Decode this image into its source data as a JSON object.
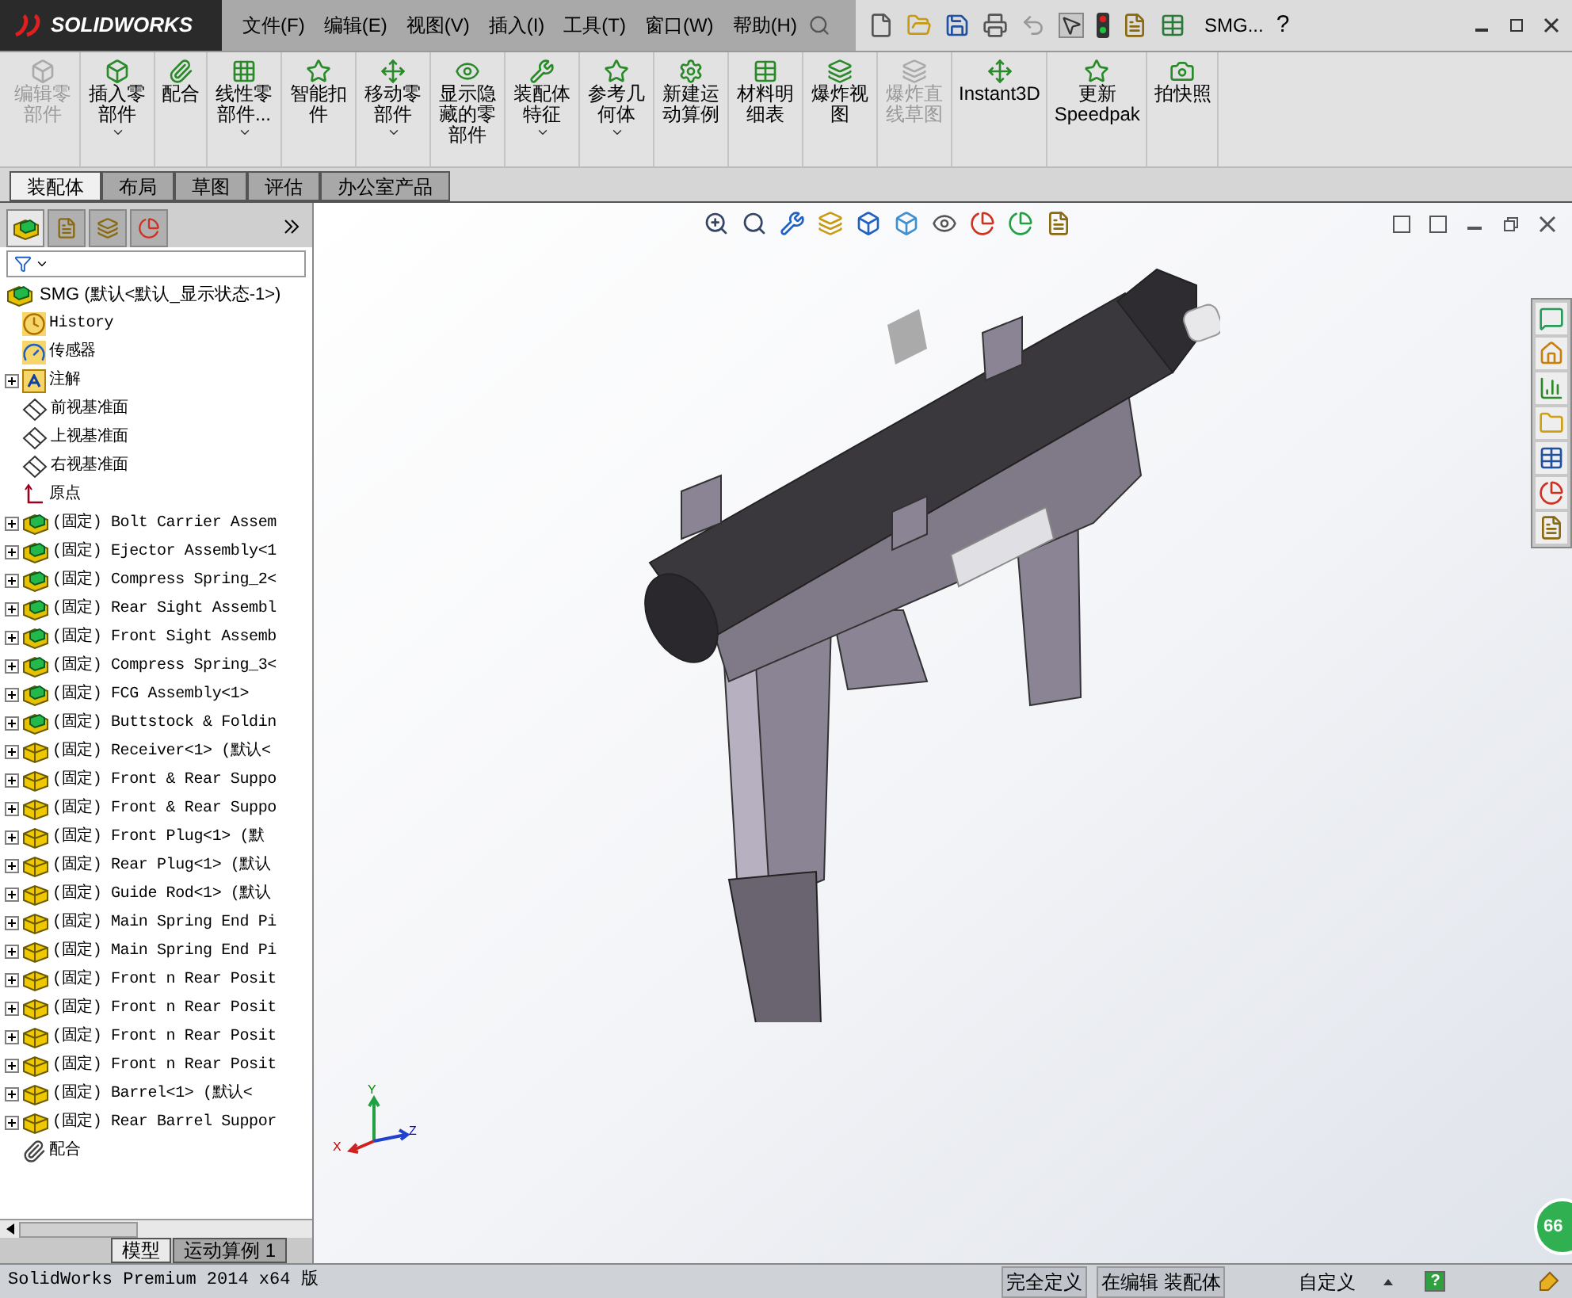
{
  "app": {
    "logo": "SOLIDWORKS"
  },
  "menu": [
    "文件(F)",
    "编辑(E)",
    "视图(V)",
    "插入(I)",
    "工具(T)",
    "窗口(W)",
    "帮助(H)"
  ],
  "title_bar": {
    "document": "SMG...",
    "help": "?"
  },
  "ribbon": [
    {
      "label": "编辑零部件",
      "disabled": true,
      "dropdown": false
    },
    {
      "label": "插入零部件",
      "disabled": false,
      "dropdown": true
    },
    {
      "label": "配合",
      "disabled": false,
      "dropdown": false
    },
    {
      "label": "线性零部件...",
      "disabled": false,
      "dropdown": true
    },
    {
      "label": "智能扣件",
      "disabled": false,
      "dropdown": false
    },
    {
      "label": "移动零部件",
      "disabled": false,
      "dropdown": true
    },
    {
      "label": "显示隐藏的零部件",
      "disabled": false,
      "dropdown": false
    },
    {
      "label": "装配体特征",
      "disabled": false,
      "dropdown": true
    },
    {
      "label": "参考几何体",
      "disabled": false,
      "dropdown": true
    },
    {
      "label": "新建运动算例",
      "disabled": false,
      "dropdown": false
    },
    {
      "label": "材料明细表",
      "disabled": false,
      "dropdown": false
    },
    {
      "label": "爆炸视图",
      "disabled": false,
      "dropdown": false
    },
    {
      "label": "爆炸直线草图",
      "disabled": true,
      "dropdown": false
    },
    {
      "label": "Instant3D",
      "disabled": false,
      "dropdown": false
    },
    {
      "label": "更新Speedpak",
      "disabled": false,
      "dropdown": false
    },
    {
      "label": "拍快照",
      "disabled": false,
      "dropdown": false
    }
  ],
  "tabs": [
    {
      "label": "装配体",
      "selected": true
    },
    {
      "label": "布局",
      "selected": false
    },
    {
      "label": "草图",
      "selected": false
    },
    {
      "label": "评估",
      "selected": false
    },
    {
      "label": "办公室产品",
      "selected": false
    }
  ],
  "tree": {
    "root": "SMG  (默认<默认_显示状态-1>)",
    "items": [
      {
        "kind": "history",
        "label": "History"
      },
      {
        "kind": "sensor",
        "label": "传感器"
      },
      {
        "kind": "annotation",
        "label": "注解",
        "expanded": false
      },
      {
        "kind": "plane",
        "label": "前视基准面"
      },
      {
        "kind": "plane",
        "label": "上视基准面"
      },
      {
        "kind": "plane",
        "label": "右视基准面"
      },
      {
        "kind": "origin",
        "label": "原点"
      },
      {
        "kind": "assembly",
        "label": "(固定) Bolt Carrier Assem",
        "expanded": false
      },
      {
        "kind": "assembly",
        "label": "(固定) Ejector Assembly<1",
        "expanded": false
      },
      {
        "kind": "assembly",
        "label": "(固定) Compress Spring_2<",
        "expanded": false
      },
      {
        "kind": "assembly",
        "label": "(固定) Rear Sight Assembl",
        "expanded": false
      },
      {
        "kind": "assembly",
        "label": "(固定) Front Sight Assemb",
        "expanded": false
      },
      {
        "kind": "assembly",
        "label": "(固定) Compress Spring_3<",
        "expanded": false
      },
      {
        "kind": "assembly",
        "label": "(固定) FCG Assembly<1>",
        "expanded": false
      },
      {
        "kind": "assembly",
        "label": "(固定) Buttstock & Foldin",
        "expanded": false
      },
      {
        "kind": "part",
        "label": "(固定) Receiver<1> (默认<",
        "expanded": false
      },
      {
        "kind": "part",
        "label": "(固定) Front & Rear Suppo",
        "expanded": false
      },
      {
        "kind": "part",
        "label": "(固定) Front & Rear Suppo",
        "expanded": false
      },
      {
        "kind": "part",
        "label": "(固定) Front Plug<1> (默",
        "expanded": false
      },
      {
        "kind": "part",
        "label": "(固定) Rear Plug<1> (默认",
        "expanded": false
      },
      {
        "kind": "part",
        "label": "(固定) Guide Rod<1> (默认",
        "expanded": false
      },
      {
        "kind": "part",
        "label": "(固定) Main Spring End Pi",
        "expanded": false
      },
      {
        "kind": "part",
        "label": "(固定) Main Spring End Pi",
        "expanded": false
      },
      {
        "kind": "part",
        "label": "(固定) Front n Rear Posit",
        "expanded": false
      },
      {
        "kind": "part",
        "label": "(固定) Front n Rear Posit",
        "expanded": false
      },
      {
        "kind": "part",
        "label": "(固定) Front n Rear Posit",
        "expanded": false
      },
      {
        "kind": "part",
        "label": "(固定) Front n Rear Posit",
        "expanded": false
      },
      {
        "kind": "part",
        "label": "(固定) Barrel<1> (默认<",
        "expanded": false
      },
      {
        "kind": "part",
        "label": "(固定) Rear Barrel Suppor",
        "expanded": false
      },
      {
        "kind": "mates",
        "label": "配合"
      }
    ]
  },
  "bottom_tabs": [
    {
      "label": "模型",
      "selected": true
    },
    {
      "label": "运动算例 1",
      "selected": false
    }
  ],
  "viewport": {
    "triad": [
      "X",
      "Y",
      "Z"
    ],
    "badge": "66"
  },
  "status_bar": {
    "product": "SolidWorks Premium 2014 x64 版",
    "definition": "完全定义",
    "mode": "在编辑 装配体",
    "units": "自定义",
    "help": "?"
  }
}
